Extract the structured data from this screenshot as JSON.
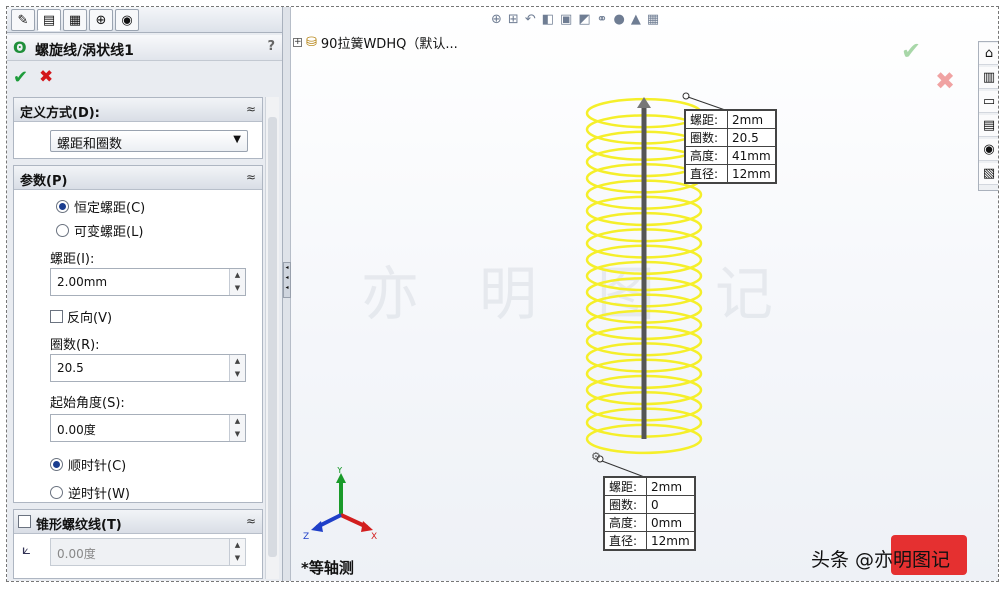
{
  "property_manager": {
    "title": "螺旋线/涡状线1",
    "help": "?",
    "tabs": [
      "feature-manager-icon",
      "property-manager-icon",
      "configuration-manager-icon",
      "dim-expert-icon",
      "display-manager-icon"
    ],
    "define_group": {
      "title": "定义方式(D):",
      "selected": "螺距和圈数"
    },
    "params_group": {
      "title": "参数(P)",
      "constant_pitch": "恒定螺距(C)",
      "variable_pitch": "可变螺距(L)",
      "pitch_label": "螺距(I):",
      "pitch_value": "2.00mm",
      "reverse_label": "反向(V)",
      "revolutions_label": "圈数(R):",
      "revolutions_value": "20.5",
      "start_angle_label": "起始角度(S):",
      "start_angle_value": "0.00度",
      "clockwise": "顺时针(C)",
      "counterclockwise": "逆时针(W)"
    },
    "taper_group": {
      "title": "锥形螺纹线(T)",
      "angle_value": "0.00度"
    }
  },
  "graphics": {
    "tree_node_label": "90拉簧WDHQ（默认...",
    "view_name": "*等轴测",
    "helix_color": "#f5ef2a",
    "axis_color": "#555555",
    "callout_top": [
      {
        "key": "螺距:",
        "value": "2mm"
      },
      {
        "key": "圈数:",
        "value": "20.5"
      },
      {
        "key": "高度:",
        "value": "41mm"
      },
      {
        "key": "直径:",
        "value": "12mm"
      }
    ],
    "callout_bottom": [
      {
        "key": "螺距:",
        "value": "2mm"
      },
      {
        "key": "圈数:",
        "value": "0"
      },
      {
        "key": "高度:",
        "value": "0mm"
      },
      {
        "key": "直径:",
        "value": "12mm"
      }
    ],
    "triad": {
      "x": "X",
      "y": "Y",
      "z": "Z"
    },
    "watermark": "亦明图记",
    "signature": "头条 @亦明图记"
  }
}
